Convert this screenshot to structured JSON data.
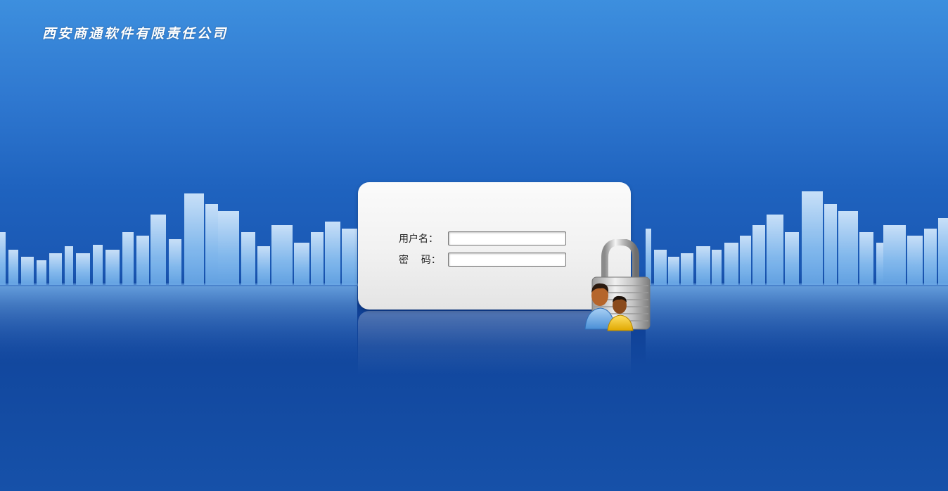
{
  "header": {
    "company_name": "西安商通软件有限责任公司"
  },
  "login": {
    "username_label": "用户名：",
    "username_value": "",
    "password_label": "密    码：",
    "password_value": ""
  },
  "icons": {
    "lock": "padlock-icon",
    "users": "users-icon"
  },
  "colors": {
    "background_top": "#3d8fde",
    "background_bottom": "#1651a9",
    "panel": "#f4f4f4"
  }
}
